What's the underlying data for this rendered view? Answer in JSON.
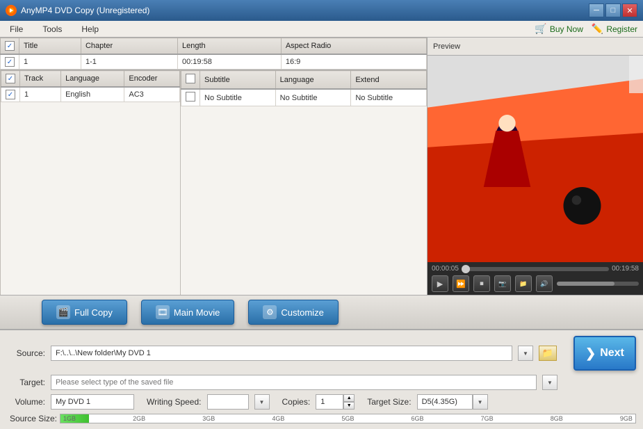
{
  "app": {
    "title": "AnyMP4 DVD Copy (Unregistered)",
    "icon": "▶",
    "buy_now": "Buy Now",
    "register": "Register"
  },
  "menu": {
    "items": [
      "File",
      "Tools",
      "Help"
    ]
  },
  "video_table": {
    "columns": [
      "",
      "Title",
      "Chapter",
      "Length",
      "Aspect Radio"
    ],
    "rows": [
      {
        "checked": true,
        "title": "1",
        "chapter": "1-1",
        "length": "00:19:58",
        "aspect": "16:9"
      }
    ]
  },
  "audio_table": {
    "columns": [
      "",
      "Track",
      "Language",
      "Encoder"
    ],
    "rows": [
      {
        "checked": true,
        "track": "1",
        "language": "English",
        "encoder": "AC3"
      }
    ]
  },
  "subtitle_table": {
    "columns": [
      "",
      "Subtitle",
      "Language",
      "Extend"
    ],
    "rows": [
      {
        "checked": false,
        "subtitle": "No Subtitle",
        "language": "No Subtitle",
        "extend": "No Subtitle"
      }
    ]
  },
  "preview": {
    "label": "Preview"
  },
  "player": {
    "time_current": "00:00:05",
    "time_total": "00:19:58"
  },
  "actions": {
    "full_copy": "Full Copy",
    "main_movie": "Main Movie",
    "customize": "Customize"
  },
  "bottom": {
    "source_label": "Source:",
    "source_value": "F:\\..\\..\\New folder\\My DVD 1",
    "target_label": "Target:",
    "target_placeholder": "Please select type of the saved file",
    "volume_label": "Volume:",
    "volume_value": "My DVD 1",
    "writing_speed_label": "Writing Speed:",
    "writing_speed_placeholder": "",
    "copies_label": "Copies:",
    "copies_value": "1",
    "target_size_label": "Target Size:",
    "target_size_value": "D5(4.35G)",
    "size_bar_label": "Source Size:",
    "size_bar_ticks": [
      "1GB",
      "2GB",
      "3GB",
      "4GB",
      "5GB",
      "6GB",
      "7GB",
      "8GB",
      "9GB"
    ]
  },
  "next_btn": "Next",
  "next_icon": "❯"
}
